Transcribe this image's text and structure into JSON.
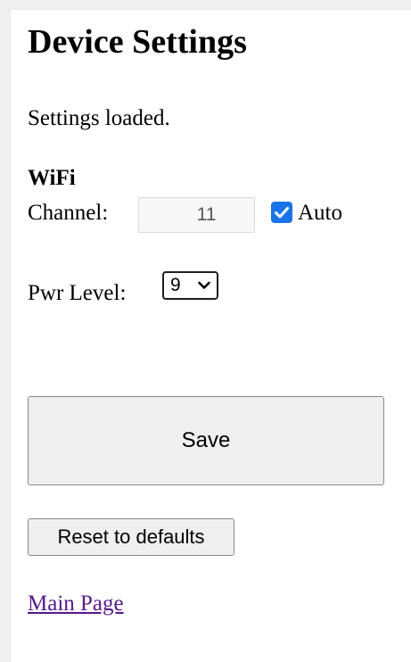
{
  "page": {
    "title": "Device Settings",
    "status": "Settings loaded."
  },
  "wifi": {
    "heading": "WiFi",
    "channel_label": "Channel:",
    "channel_value": "11",
    "auto_label": "Auto",
    "auto_checked": true,
    "pwr_label": "Pwr Level:",
    "pwr_value": "9"
  },
  "actions": {
    "save_label": "Save",
    "reset_label": "Reset to defaults",
    "main_link_label": "Main Page"
  },
  "colors": {
    "checkbox_accent": "#1a73e8",
    "visited_link": "#551a8b",
    "button_bg": "#efefef"
  },
  "icons": {
    "checkbox": "checkmark-icon",
    "select": "chevron-down-icon"
  }
}
